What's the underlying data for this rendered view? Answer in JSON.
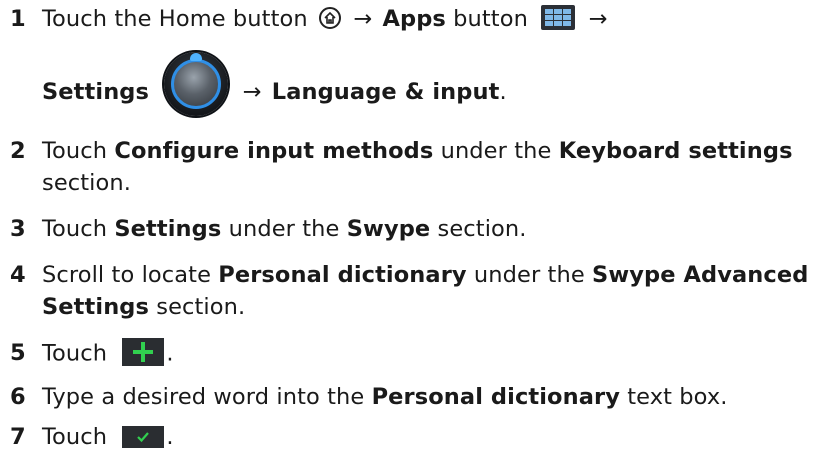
{
  "steps": [
    {
      "num": "1",
      "l1_a": "Touch the Home button",
      "arrow1": "→",
      "l1_b": "Apps",
      "l1_c": " button",
      "arrow2": "→",
      "l2_a": "Settings",
      "arrow3": "→",
      "l2_b": "Language & input",
      "l2_c": "."
    },
    {
      "num": "2",
      "l1_a": "Touch ",
      "l1_b": "Configure input methods",
      "l1_c": " under the ",
      "l1_d": "Keyboard settings",
      "l2_a": "section."
    },
    {
      "num": "3",
      "a": "Touch ",
      "b": "Settings",
      "c": " under the ",
      "d": "Swype",
      "e": " section."
    },
    {
      "num": "4",
      "l1_a": "Scroll to locate ",
      "l1_b": "Personal dictionary",
      "l1_c": " under the ",
      "l1_d": "Swype Advanced",
      "l2_a": "Settings",
      "l2_b": " section."
    },
    {
      "num": "5",
      "a": "Touch",
      "b": "."
    },
    {
      "num": "6",
      "a": "Type a desired word into the ",
      "b": "Personal dictionary",
      "c": " text box."
    },
    {
      "num": "7",
      "a": "Touch",
      "b": "."
    }
  ],
  "icons": {
    "home": "home-icon",
    "apps": "apps-grid-icon",
    "settings": "settings-knob-icon",
    "add": "plus-icon",
    "confirm": "checkmark-icon"
  },
  "colors": {
    "text": "#1a1a1a",
    "accent_blue": "#2f8fe6",
    "accent_green": "#31d04f"
  }
}
